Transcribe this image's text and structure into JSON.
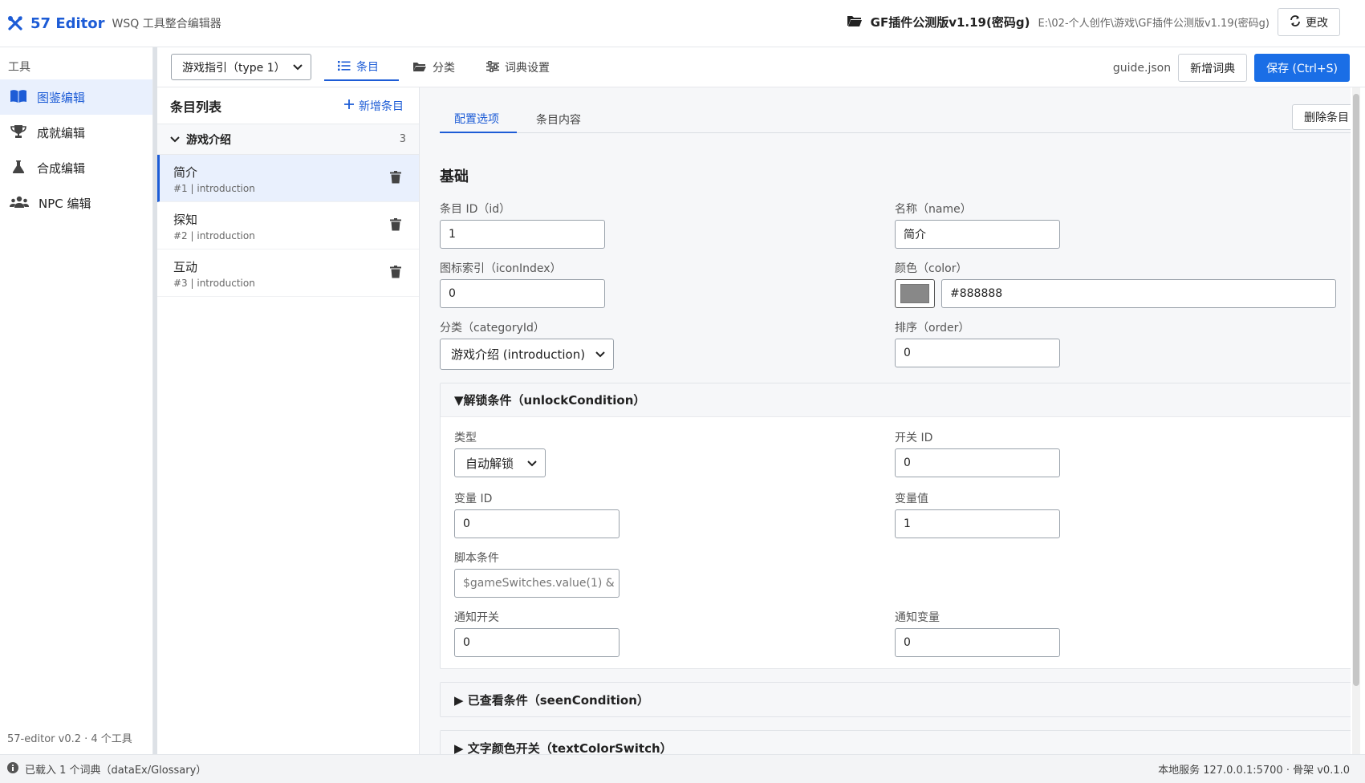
{
  "header": {
    "app_name": "57 Editor",
    "app_subtitle": "WSQ 工具整合编辑器",
    "project_name": "GF插件公测版v1.19(密码g)",
    "project_path": "E:\\02-个人创作\\游戏\\GF插件公测版v1.19(密码g)",
    "change_label": "更改",
    "accent_color": "#1d5cd6"
  },
  "sidebar": {
    "header": "工具",
    "items": [
      {
        "label": "图鉴编辑",
        "icon": "book-icon"
      },
      {
        "label": "成就编辑",
        "icon": "trophy-icon"
      },
      {
        "label": "合成编辑",
        "icon": "flask-icon"
      },
      {
        "label": "NPC 编辑",
        "icon": "users-icon"
      }
    ],
    "footer": "57-editor v0.2 · 4 个工具"
  },
  "toolbar": {
    "dict_select": "游戏指引（type 1）",
    "tabs": [
      {
        "label": "条目",
        "icon": "list-icon"
      },
      {
        "label": "分类",
        "icon": "folder-icon"
      },
      {
        "label": "词典设置",
        "icon": "sliders-icon"
      }
    ],
    "file_name": "guide.json",
    "new_dict_label": "新增词典",
    "save_label": "保存 (Ctrl+S)"
  },
  "entry_list": {
    "title": "条目列表",
    "add_label": "新增条目",
    "group": {
      "name": "游戏介绍",
      "count": "3"
    },
    "entries": [
      {
        "name": "简介",
        "meta": "#1 | introduction"
      },
      {
        "name": "探知",
        "meta": "#2 | introduction"
      },
      {
        "name": "互动",
        "meta": "#3 | introduction"
      }
    ]
  },
  "detail": {
    "tabs": [
      "配置选项",
      "条目内容"
    ],
    "delete_label": "删除条目",
    "section_title": "基础",
    "fields": {
      "id_label": "条目 ID（id）",
      "id_value": "1",
      "name_label": "名称（name）",
      "name_value": "简介",
      "icon_label": "图标索引（iconIndex）",
      "icon_value": "0",
      "color_label": "颜色（color）",
      "color_value": "#888888",
      "category_label": "分类（categoryId）",
      "category_value": "游戏介绍 (introduction)",
      "order_label": "排序（order）",
      "order_value": "0"
    },
    "unlock": {
      "title": "▼解锁条件（unlockCondition）",
      "type_label": "类型",
      "type_value": "自动解锁",
      "switch_label": "开关 ID",
      "switch_value": "0",
      "var_label": "变量 ID",
      "var_value": "0",
      "varval_label": "变量值",
      "varval_value": "1",
      "script_label": "脚本条件",
      "script_placeholder": "$gameSwitches.value(1) &",
      "notify_switch_label": "通知开关",
      "notify_switch_value": "0",
      "notify_var_label": "通知变量",
      "notify_var_value": "0"
    },
    "seen_title": "▶ 已查看条件（seenCondition）",
    "textcolor_title": "▶ 文字颜色开关（textColorSwitch）"
  },
  "statusbar": {
    "left": "已载入 1 个词典（dataEx/Glossary）",
    "right": "本地服务 127.0.0.1:5700 · 骨架 v0.1.0"
  }
}
